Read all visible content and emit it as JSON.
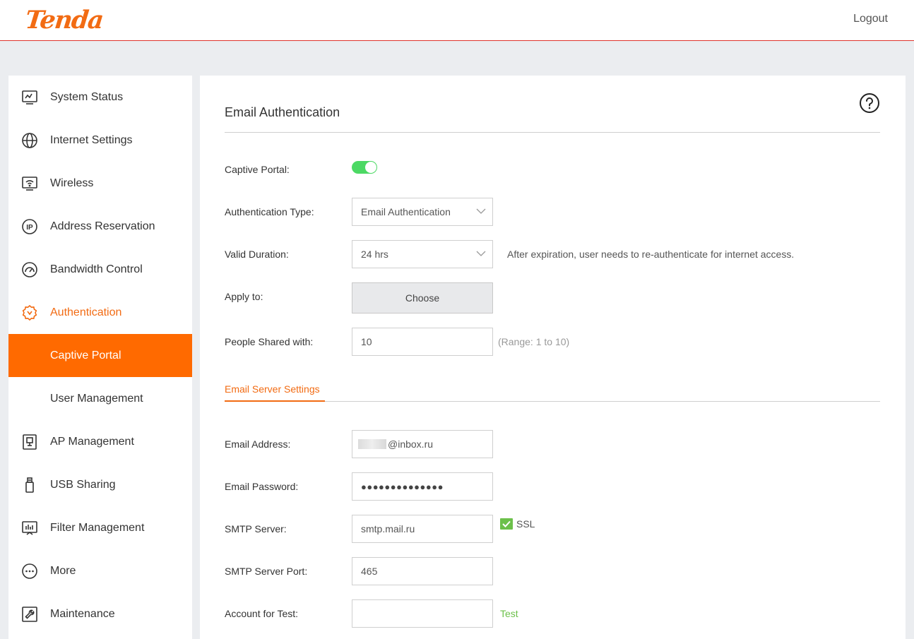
{
  "header": {
    "logo_text": "Tenda",
    "logout_label": "Logout"
  },
  "sidebar": {
    "items": [
      {
        "label": "System Status",
        "icon": "system-status-icon"
      },
      {
        "label": "Internet Settings",
        "icon": "globe-icon"
      },
      {
        "label": "Wireless",
        "icon": "wifi-monitor-icon"
      },
      {
        "label": "Address Reservation",
        "icon": "ip-icon"
      },
      {
        "label": "Bandwidth Control",
        "icon": "gauge-icon"
      },
      {
        "label": "Authentication",
        "icon": "badge-check-icon"
      },
      {
        "label": "Captive Portal"
      },
      {
        "label": "User Management"
      },
      {
        "label": "AP Management",
        "icon": "ap-icon"
      },
      {
        "label": "USB Sharing",
        "icon": "usb-icon"
      },
      {
        "label": "Filter Management",
        "icon": "filter-chart-icon"
      },
      {
        "label": "More",
        "icon": "more-icon"
      },
      {
        "label": "Maintenance",
        "icon": "wrench-icon"
      }
    ]
  },
  "main": {
    "title": "Email Authentication",
    "captive_portal": {
      "label": "Captive Portal:",
      "enabled": true
    },
    "auth_type": {
      "label": "Authentication Type:",
      "value": "Email Authentication"
    },
    "valid_duration": {
      "label": "Valid Duration:",
      "value": "24 hrs",
      "hint": "After expiration, user needs to re-authenticate for internet access."
    },
    "apply_to": {
      "label": "Apply to:",
      "button": "Choose"
    },
    "people_shared": {
      "label": "People Shared with:",
      "value": "10",
      "hint": "(Range: 1 to 10)"
    },
    "email_server_tab": "Email Server Settings",
    "email_address": {
      "label": "Email Address:",
      "value": "@inbox.ru"
    },
    "email_password": {
      "label": "Email Password:",
      "value": "●●●●●●●●●●●●●●"
    },
    "smtp_server": {
      "label": "SMTP Server:",
      "value": "smtp.mail.ru",
      "ssl_label": "SSL",
      "ssl_checked": true
    },
    "smtp_port": {
      "label": "SMTP Server Port:",
      "value": "465"
    },
    "account_test": {
      "label": "Account for Test:",
      "value": "",
      "test_label": "Test"
    }
  },
  "colors": {
    "brand": "#f26b13",
    "active_bg": "#ff6a00",
    "toggle_on": "#4cd964",
    "link_green": "#6cc04a",
    "header_line": "#e0342c"
  }
}
